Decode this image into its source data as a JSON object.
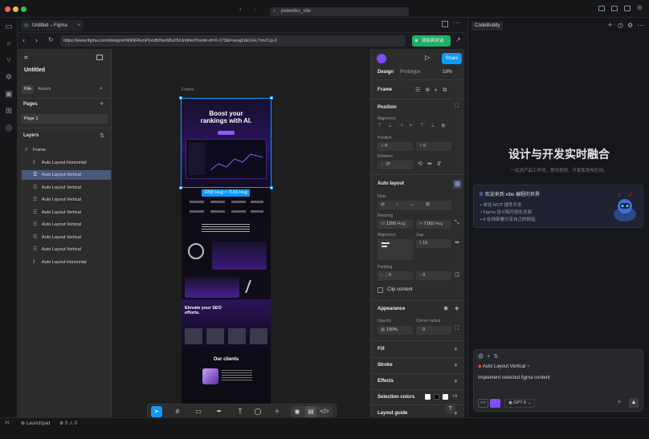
{
  "titlebar": {
    "search_text": "psleedex_site"
  },
  "tab": {
    "label": "Untitled – Figma"
  },
  "urlbar": {
    "url": "https://www.figma.com/design/nNNNFAxnF5xxB0fan6Bx05/Untitled?node-id=0-173&t=avaj2zEUHL7mvCrg-0",
    "add_mark_label": "添加到对话"
  },
  "figma_left": {
    "file_name": "Untitled",
    "tabs": [
      "File",
      "Assets"
    ],
    "pages_label": "Pages",
    "pages": [
      "Page 1"
    ],
    "layers_label": "Layers",
    "layers": [
      "Frame",
      "Auto Layout Horizontal",
      "Auto Layout Vertical",
      "Auto Layout Vertical",
      "Auto Layout Vertical",
      "Auto Layout Vertical",
      "Auto Layout Vertical",
      "Auto Layout Vertical",
      "Auto Layout Vertical",
      "Auto Layout Horizontal"
    ]
  },
  "canvas": {
    "frame_label": "Frame",
    "size_badge": "1200 Hug × 7165 Hug",
    "hero_title": "Boost your rankings with AI.",
    "elevate_title": "Elevate your SEO efforts.",
    "clients_title": "Our clients"
  },
  "figma_right": {
    "share_label": "Share",
    "tabs": [
      "Design",
      "Prototype"
    ],
    "zoom": "19%",
    "frame_label": "Frame",
    "position_label": "Position",
    "alignment_label": "Alignment",
    "position_sub": "Position",
    "x_value": "0",
    "y_value": "0",
    "rotation_label": "Rotation",
    "rotation_value": "0°",
    "auto_layout_label": "Auto layout",
    "flow_label": "Flow",
    "resizing_label": "Resizing",
    "w_label": "W",
    "w_value": "1200",
    "w_mode": "Hug",
    "h_label": "H",
    "h_value": "7165",
    "h_mode": "Hug",
    "alignment2_label": "Alignment",
    "gap_label": "Gap",
    "gap_value": "10",
    "padding_label": "Padding",
    "padding_h": "0",
    "padding_v": "0",
    "clip_label": "Clip content",
    "appearance_label": "Appearance",
    "opacity_label": "Opacity",
    "opacity_value": "100%",
    "radius_label": "Corner radius",
    "radius_value": "0",
    "fill_label": "Fill",
    "stroke_label": "Stroke",
    "effects_label": "Effects",
    "selection_colors_label": "Selection colors",
    "selection_more": "+9",
    "layout_guide_label": "Layout guide"
  },
  "codebuddy": {
    "title": "CodeBuddy",
    "hero": "设计与开发实时融合",
    "subtitle": "一站式产品工作流，想法规划、开发和发布应用。",
    "card_title": "欢迎来到 vibe 编程的世界",
    "card_items": [
      "体验 MCP 插件开发",
      "Figma 设计稿可视化还原",
      "0 在线部署分享自己的网站"
    ],
    "context_chip": "Auto Layout Vertical",
    "input_text": "Implement selected figma content",
    "model": "GPT-5"
  },
  "statusbar": {
    "launchpad": "Launchpad",
    "errors": "0",
    "warnings": "0"
  },
  "colors": {
    "accent": "#0d99ff",
    "purple": "#7d4dff",
    "green": "#1fae6a",
    "selected": "#4a5a7a"
  }
}
